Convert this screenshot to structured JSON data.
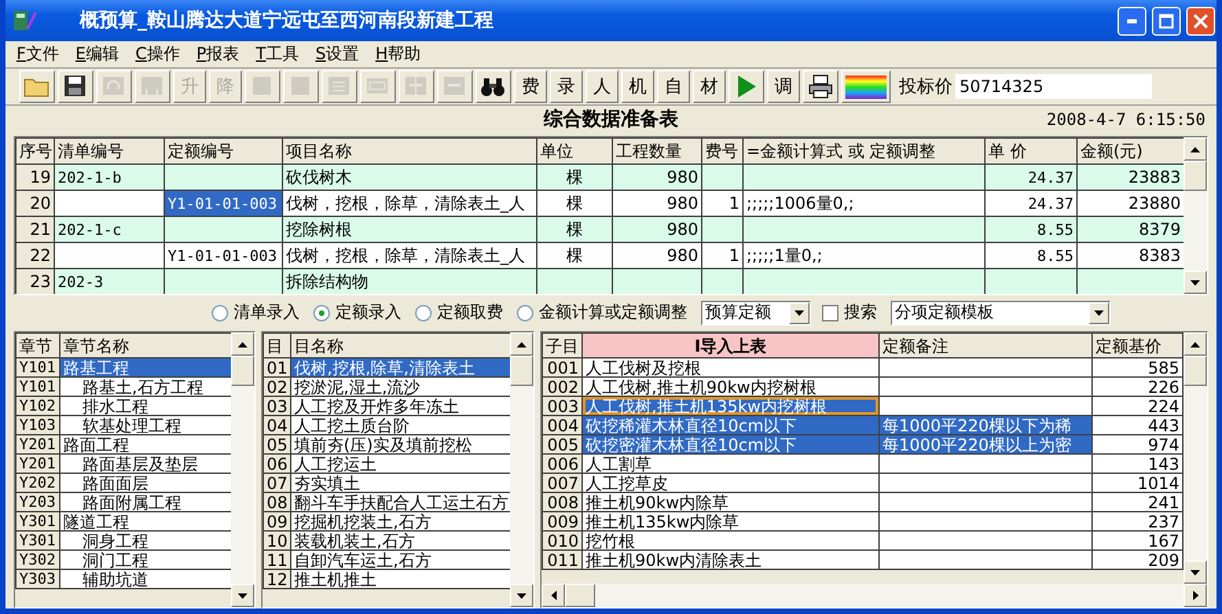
{
  "window": {
    "title": "概预算_鞍山腾达大道宁远屯至西河南段新建工程"
  },
  "menu": [
    "F文件",
    "E编辑",
    "C操作",
    "P报表",
    "T工具",
    "S设置",
    "H帮助"
  ],
  "toolbar": {
    "items": [
      {
        "kind": "icon",
        "disabled": false
      },
      {
        "kind": "icon",
        "disabled": false
      },
      {
        "kind": "icon",
        "disabled": true
      },
      {
        "kind": "icon",
        "disabled": true
      },
      {
        "kind": "text",
        "label": "升",
        "disabled": true
      },
      {
        "kind": "text",
        "label": "降",
        "disabled": true
      },
      {
        "kind": "icon",
        "disabled": true
      },
      {
        "kind": "icon",
        "disabled": true
      },
      {
        "kind": "icon",
        "disabled": true
      },
      {
        "kind": "icon",
        "disabled": true
      },
      {
        "kind": "icon",
        "disabled": true
      },
      {
        "kind": "icon",
        "disabled": true
      },
      {
        "kind": "icon",
        "disabled": false
      },
      {
        "kind": "text",
        "label": "费",
        "disabled": false
      },
      {
        "kind": "text",
        "label": "录",
        "disabled": false
      },
      {
        "kind": "text",
        "label": "人",
        "disabled": false
      },
      {
        "kind": "text",
        "label": "机",
        "disabled": false
      },
      {
        "kind": "text",
        "label": "自",
        "disabled": false
      },
      {
        "kind": "text",
        "label": "材",
        "disabled": false
      },
      {
        "kind": "icon",
        "disabled": false
      },
      {
        "kind": "text",
        "label": "调",
        "disabled": false
      },
      {
        "kind": "icon",
        "disabled": false
      },
      {
        "kind": "icon",
        "disabled": false
      }
    ],
    "bid_label": "投标价",
    "bid_value": "50714325"
  },
  "heading": {
    "title": "综合数据准备表",
    "datetime": "2008-4-7 6:15:50"
  },
  "top_table": {
    "columns": [
      "序号",
      "清单编号",
      "定额编号",
      "项目名称",
      "单位",
      "工程数量",
      "费号",
      "=金额计算式 或 定额调整",
      "单 价",
      "金额(元)"
    ],
    "rows": [
      {
        "kind": "bill",
        "selected": false,
        "no": "19",
        "bill_code": "202-1-b",
        "name": "砍伐树木",
        "unit": "棵",
        "quantity": "980",
        "unit_price": "24.37",
        "amount": "23883"
      },
      {
        "kind": "quota",
        "selected": true,
        "no": "20",
        "quota_code": "Y1-01-01-003",
        "name": "伐树，挖根，除草，清除表土_人",
        "unit": "棵",
        "quantity": "980",
        "fee_no": "1",
        "formula": ";;;;;1006量0,;",
        "unit_price": "24.37",
        "amount": "23880"
      },
      {
        "kind": "bill",
        "selected": false,
        "no": "21",
        "bill_code": "202-1-c",
        "name": "挖除树根",
        "unit": "棵",
        "quantity": "980",
        "unit_price": "8.55",
        "amount": "8379"
      },
      {
        "kind": "quota",
        "selected": false,
        "no": "22",
        "quota_code": "Y1-01-01-003",
        "name": "伐树，挖根，除草，清除表土_人",
        "unit": "棵",
        "quantity": "980",
        "fee_no": "1",
        "formula": ";;;;;1量0,;",
        "unit_price": "8.55",
        "amount": "8383"
      },
      {
        "kind": "bill",
        "selected": false,
        "no": "23",
        "bill_code": "202-3",
        "name": "拆除结构物"
      }
    ]
  },
  "options": {
    "radios": [
      {
        "label": "清单录入",
        "selected": false
      },
      {
        "label": "定额录入",
        "selected": true
      },
      {
        "label": "定额取费",
        "selected": false
      },
      {
        "label": "金额计算或定额调整",
        "selected": false
      }
    ],
    "quota_dropdown": "预算定额",
    "search": {
      "label": "搜索",
      "checked": false
    },
    "template_dropdown": "分项定额模板"
  },
  "chapters": {
    "columns": [
      "章节",
      "章节名称"
    ],
    "rows": [
      {
        "code": "Y101",
        "name": "路基工程",
        "selected": true,
        "children": [
          {
            "code": "Y101",
            "name": "路基土,石方工程",
            "selected": false
          },
          {
            "code": "Y102",
            "name": "排水工程",
            "selected": false
          },
          {
            "code": "Y103",
            "name": "软基处理工程",
            "selected": false
          }
        ]
      },
      {
        "code": "Y201",
        "name": "路面工程",
        "selected": false,
        "children": [
          {
            "code": "Y201",
            "name": "路面基层及垫层",
            "selected": false
          },
          {
            "code": "Y202",
            "name": "路面面层",
            "selected": false
          },
          {
            "code": "Y203",
            "name": "路面附属工程",
            "selected": false
          }
        ]
      },
      {
        "code": "Y301",
        "name": "隧道工程",
        "selected": false,
        "children": [
          {
            "code": "Y301",
            "name": "洞身工程",
            "selected": false
          },
          {
            "code": "Y302",
            "name": "洞门工程",
            "selected": false
          },
          {
            "code": "Y303",
            "name": "辅助坑道",
            "selected": false
          }
        ]
      }
    ]
  },
  "sections": {
    "columns": [
      "目",
      "目名称"
    ],
    "rows": [
      {
        "code": "01",
        "name": "伐树,挖根,除草,清除表土",
        "selected": true
      },
      {
        "code": "02",
        "name": "挖淤泥,湿土,流沙",
        "selected": false
      },
      {
        "code": "03",
        "name": "人工挖及开炸多年冻土",
        "selected": false
      },
      {
        "code": "04",
        "name": "人工挖土质台阶",
        "selected": false
      },
      {
        "code": "05",
        "name": "填前夯(压)实及填前挖松",
        "selected": false
      },
      {
        "code": "06",
        "name": "人工挖运土",
        "selected": false
      },
      {
        "code": "07",
        "name": "夯实填土",
        "selected": false
      },
      {
        "code": "08",
        "name": "翻斗车手扶配合人工运土石方",
        "selected": false
      },
      {
        "code": "09",
        "name": "挖掘机挖装土,石方",
        "selected": false
      },
      {
        "code": "10",
        "name": "装载机装土,石方",
        "selected": false
      },
      {
        "code": "11",
        "name": "自卸汽车运土,石方",
        "selected": false
      },
      {
        "code": "12",
        "name": "推土机推土",
        "selected": false
      }
    ]
  },
  "items": {
    "columns": [
      "子目",
      "I导入上表",
      "定额备注",
      "定额基价"
    ],
    "rows": [
      {
        "code": "001",
        "name": "人工伐树及挖根",
        "price": "585",
        "selected": false,
        "focused": false
      },
      {
        "code": "002",
        "name": "人工伐树,推土机90kw内挖树根",
        "price": "226",
        "selected": false,
        "focused": false
      },
      {
        "code": "003",
        "name": "人工伐树,推土机135kw内挖树根",
        "price": "224",
        "selected": false,
        "focused": true
      },
      {
        "code": "004",
        "name": "砍挖稀灌木林直径10cm以下",
        "note": "每1000平220棵以下为稀",
        "price": "443",
        "selected": true,
        "focused": false
      },
      {
        "code": "005",
        "name": "砍挖密灌木林直径10cm以下",
        "note": "每1000平220棵以上为密",
        "price": "974",
        "selected": true,
        "focused": false
      },
      {
        "code": "006",
        "name": "人工割草",
        "price": "143",
        "selected": false,
        "focused": false
      },
      {
        "code": "007",
        "name": "人工挖草皮",
        "price": "1014",
        "selected": false,
        "focused": false
      },
      {
        "code": "008",
        "name": "推土机90kw内除草",
        "price": "241",
        "selected": false,
        "focused": false
      },
      {
        "code": "009",
        "name": "推土机135kw内除草",
        "price": "237",
        "selected": false,
        "focused": false
      },
      {
        "code": "010",
        "name": "挖竹根",
        "price": "167",
        "selected": false,
        "focused": false
      },
      {
        "code": "011",
        "name": "推土机90kw内清除表土",
        "price": "209",
        "selected": false,
        "focused": false
      }
    ]
  }
}
